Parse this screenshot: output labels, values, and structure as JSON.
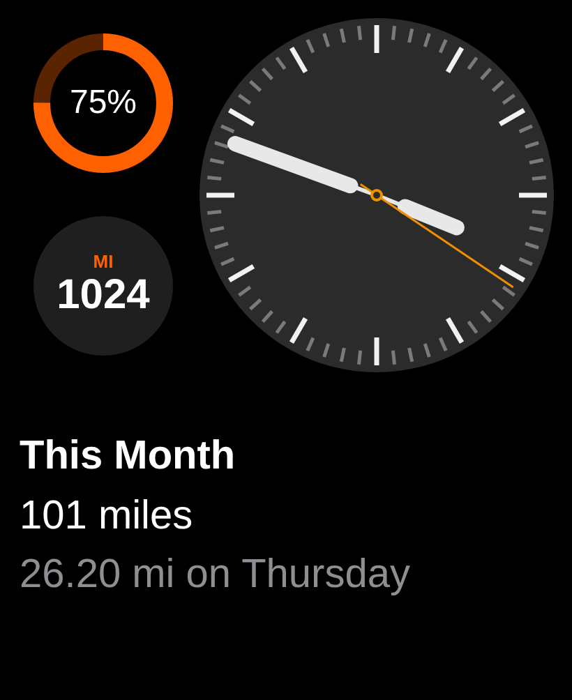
{
  "ring_complication": {
    "label": "75%",
    "level": 0.75
  },
  "distance_complication": {
    "unit": "MI",
    "value": "1024"
  },
  "summary": {
    "title": "This Month",
    "total": "101 miles",
    "detail": "26.20 mi on Thursday"
  }
}
